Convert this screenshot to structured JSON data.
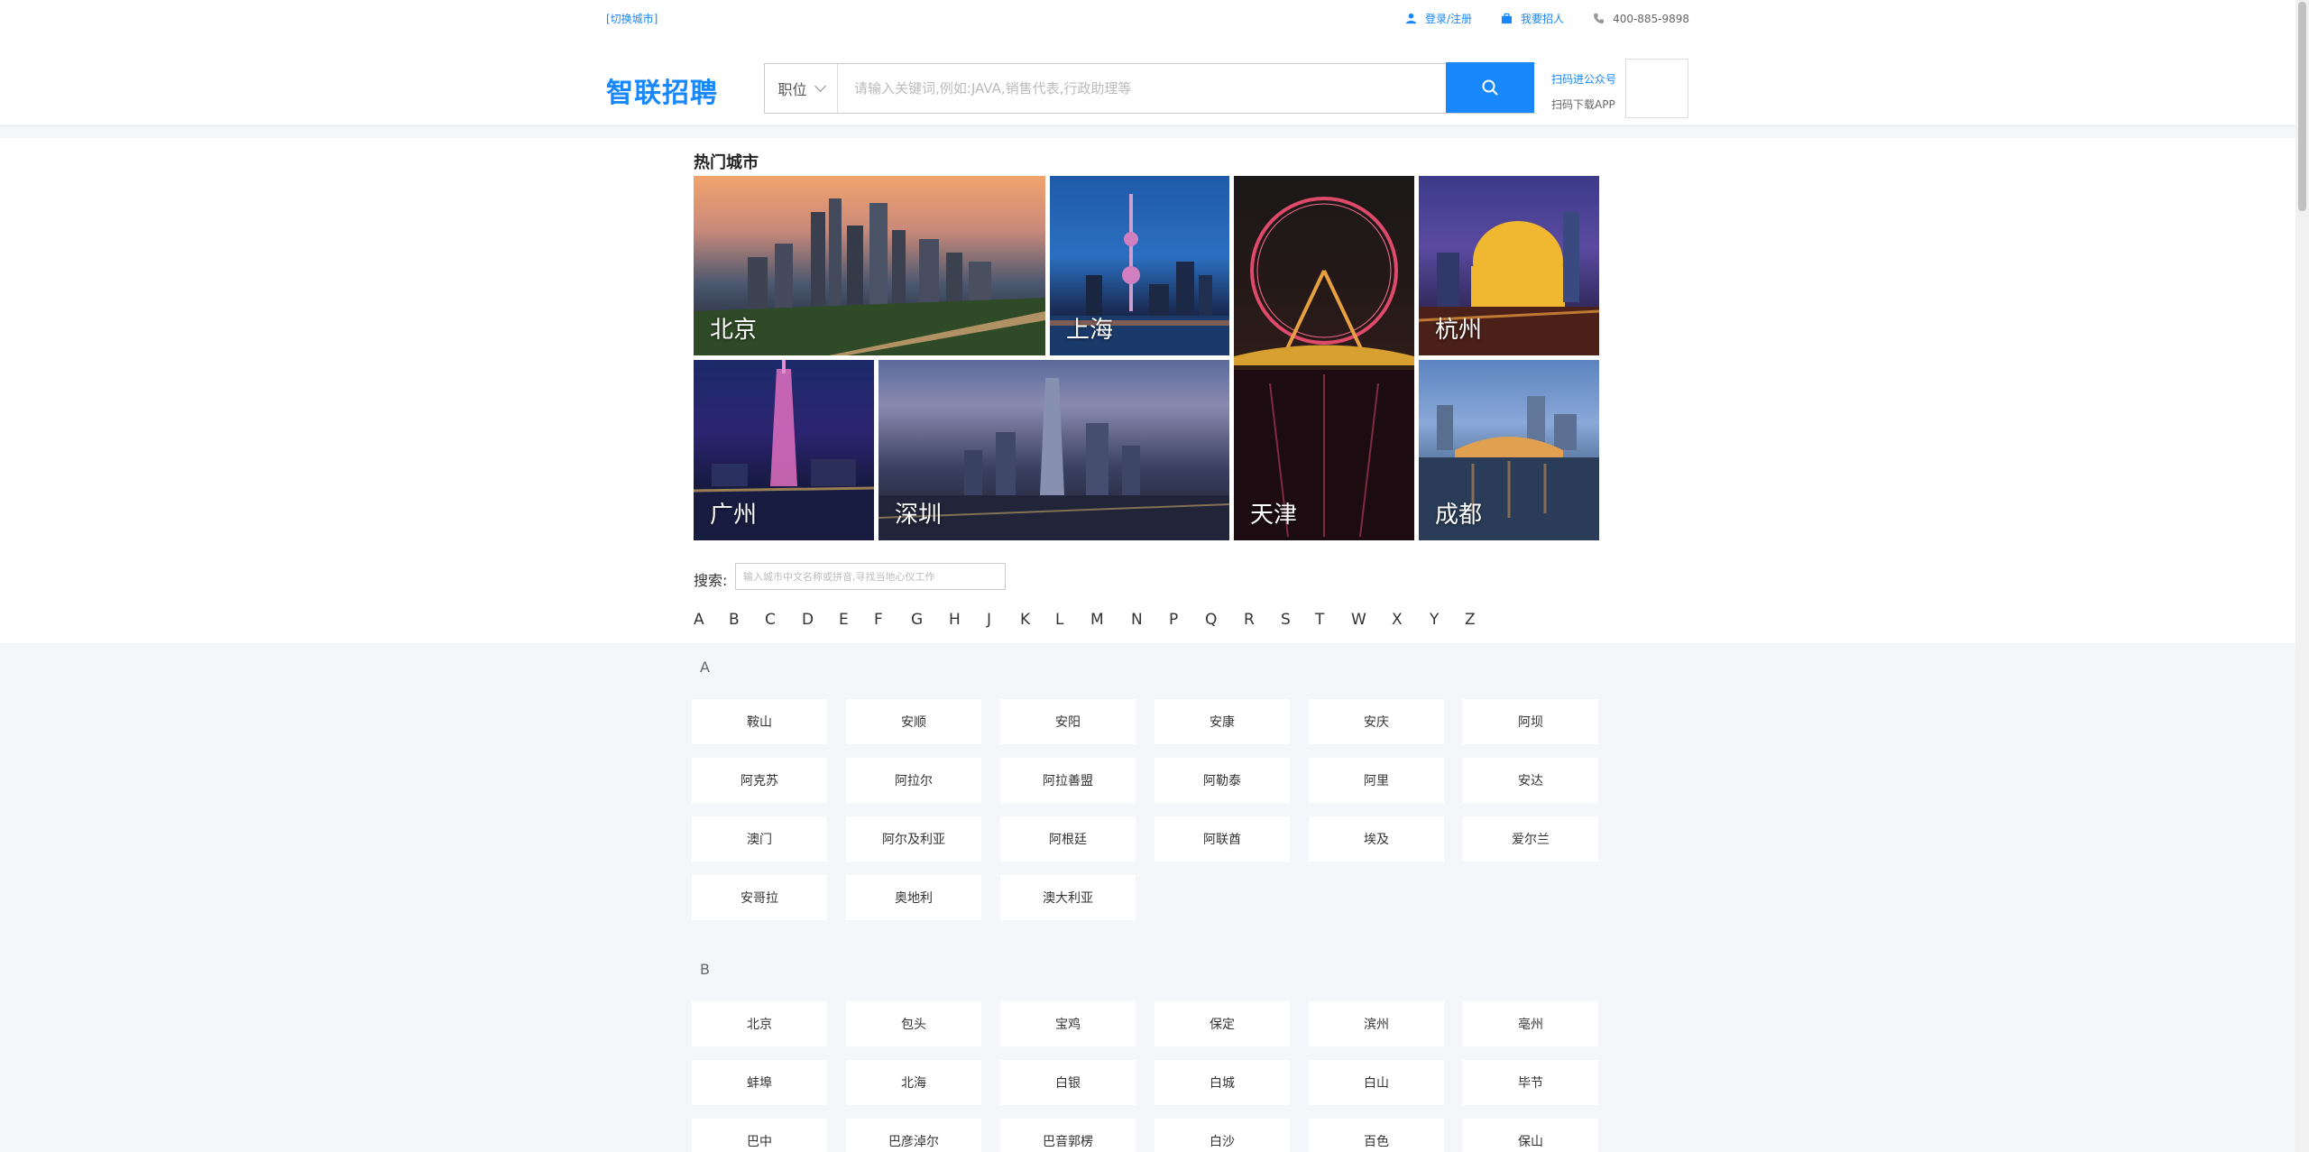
{
  "topbar": {
    "switch_city": "[切换城市]",
    "login": "登录/注册",
    "recruit": "我要招人",
    "phone": "400-885-9898"
  },
  "header": {
    "logo": "智联招聘",
    "search_type": "职位",
    "search_placeholder": "请输入关键词,例如:JAVA,销售代表,行政助理等",
    "qr_public": "扫码进公众号",
    "qr_app": "扫码下载APP"
  },
  "hot_cities": {
    "title": "热门城市",
    "cities": [
      "北京",
      "上海",
      "天津",
      "杭州",
      "广州",
      "深圳",
      "成都"
    ]
  },
  "city_search": {
    "label": "搜索:",
    "placeholder": "输入城市中文名称或拼音,寻找当地心仪工作"
  },
  "letters": [
    "A",
    "B",
    "C",
    "D",
    "E",
    "F",
    "G",
    "H",
    "J",
    "K",
    "L",
    "M",
    "N",
    "P",
    "Q",
    "R",
    "S",
    "T",
    "W",
    "X",
    "Y",
    "Z"
  ],
  "groups": [
    {
      "letter": "A",
      "cities": [
        "鞍山",
        "安顺",
        "安阳",
        "安康",
        "安庆",
        "阿坝",
        "阿克苏",
        "阿拉尔",
        "阿拉善盟",
        "阿勒泰",
        "阿里",
        "安达",
        "澳门",
        "阿尔及利亚",
        "阿根廷",
        "阿联酋",
        "埃及",
        "爱尔兰",
        "安哥拉",
        "奥地利",
        "澳大利亚"
      ]
    },
    {
      "letter": "B",
      "cities": [
        "北京",
        "包头",
        "宝鸡",
        "保定",
        "滨州",
        "亳州",
        "蚌埠",
        "北海",
        "白银",
        "白城",
        "白山",
        "毕节",
        "巴中",
        "巴彦淖尔",
        "巴音郭楞",
        "白沙",
        "百色",
        "保山"
      ]
    }
  ],
  "colors": {
    "accent": "#1787fb",
    "page_bg": "#f4f6f9"
  }
}
